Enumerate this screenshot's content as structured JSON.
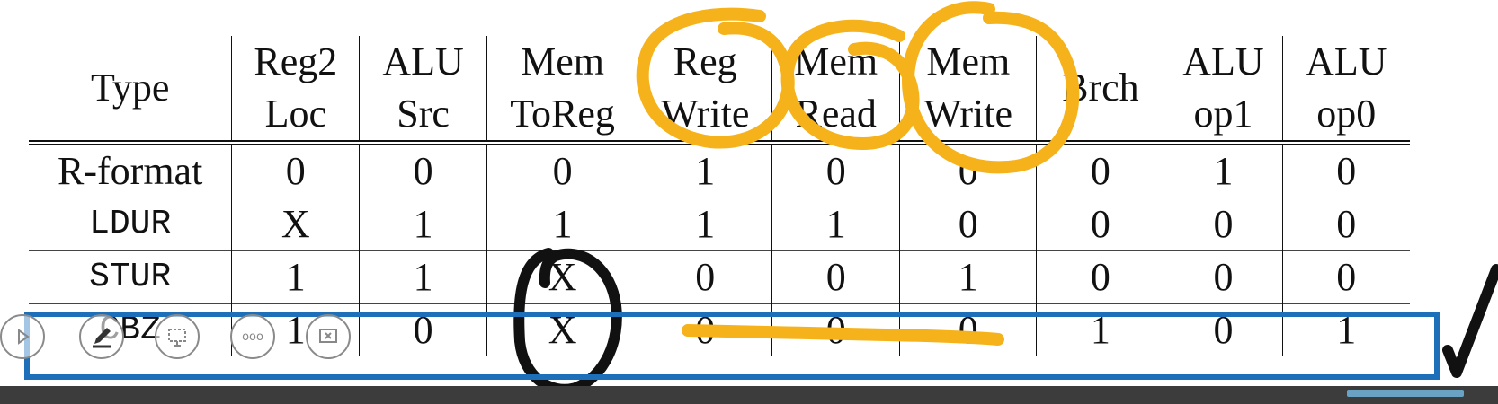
{
  "table": {
    "headers": [
      [
        "Type",
        ""
      ],
      [
        "Reg2",
        "Loc"
      ],
      [
        "ALU",
        "Src"
      ],
      [
        "Mem",
        "ToReg"
      ],
      [
        "Reg",
        "Write"
      ],
      [
        "Mem",
        "Read"
      ],
      [
        "Mem",
        "Write"
      ],
      [
        "Brch",
        ""
      ],
      [
        "ALU",
        "op1"
      ],
      [
        "ALU",
        "op0"
      ]
    ],
    "rows": [
      {
        "type": "R-format",
        "values": [
          "0",
          "0",
          "0",
          "1",
          "0",
          "0",
          "0",
          "1",
          "0"
        ]
      },
      {
        "type": "LDUR",
        "values": [
          "X",
          "1",
          "1",
          "1",
          "1",
          "0",
          "0",
          "0",
          "0"
        ]
      },
      {
        "type": "STUR",
        "values": [
          "1",
          "1",
          "X",
          "0",
          "0",
          "1",
          "0",
          "0",
          "0"
        ]
      },
      {
        "type": "CBZ",
        "values": [
          "1",
          "0",
          "X",
          "0",
          "0",
          "0",
          "1",
          "0",
          "1"
        ]
      }
    ]
  },
  "annotations": {
    "orange_color": "#f6b21b",
    "black_color": "#111111",
    "blue_color": "#1c6fb8",
    "checkmark": "check-mark"
  },
  "toolbar": {
    "buttons": [
      "play-icon",
      "pen-icon",
      "slide-icon",
      "more-icon",
      "stop-presenting-icon"
    ],
    "more_label": "ooo"
  },
  "playback": {
    "progress": 0.91
  }
}
